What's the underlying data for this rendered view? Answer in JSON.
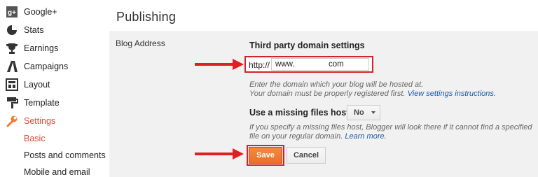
{
  "sidebar": {
    "items": [
      {
        "label": "Google+",
        "icon": "google-plus-icon"
      },
      {
        "label": "Stats",
        "icon": "pie-chart-icon"
      },
      {
        "label": "Earnings",
        "icon": "trophy-icon"
      },
      {
        "label": "Campaigns",
        "icon": "campaigns-icon"
      },
      {
        "label": "Layout",
        "icon": "layout-icon"
      },
      {
        "label": "Template",
        "icon": "paint-roller-icon"
      },
      {
        "label": "Settings",
        "icon": "wrench-icon"
      }
    ],
    "subitems": [
      {
        "label": "Basic"
      },
      {
        "label": "Posts and comments"
      },
      {
        "label": "Mobile and email"
      }
    ]
  },
  "page": {
    "title": "Publishing",
    "blog_address_label": "Blog Address"
  },
  "domain": {
    "heading": "Third party domain settings",
    "prefix": "http://",
    "www": "www.",
    "com": "com",
    "hint_line1": "Enter the domain which your blog will be hosted at.",
    "hint_line2": "Your domain must be properly registered first.",
    "hint_link": "View settings instructions."
  },
  "missing_host": {
    "label": "Use a missing files host?",
    "value": "No",
    "hint_line1": "If you specify a missing files host, Blogger will look there if it cannot find a specified",
    "hint_line2": "file on your regular domain.",
    "hint_link": "Learn more."
  },
  "actions": {
    "save_label": "Save",
    "cancel_label": "Cancel"
  },
  "colors": {
    "accent": "#dd4b39",
    "highlight": "#d2232a",
    "save": "#f07b33"
  }
}
